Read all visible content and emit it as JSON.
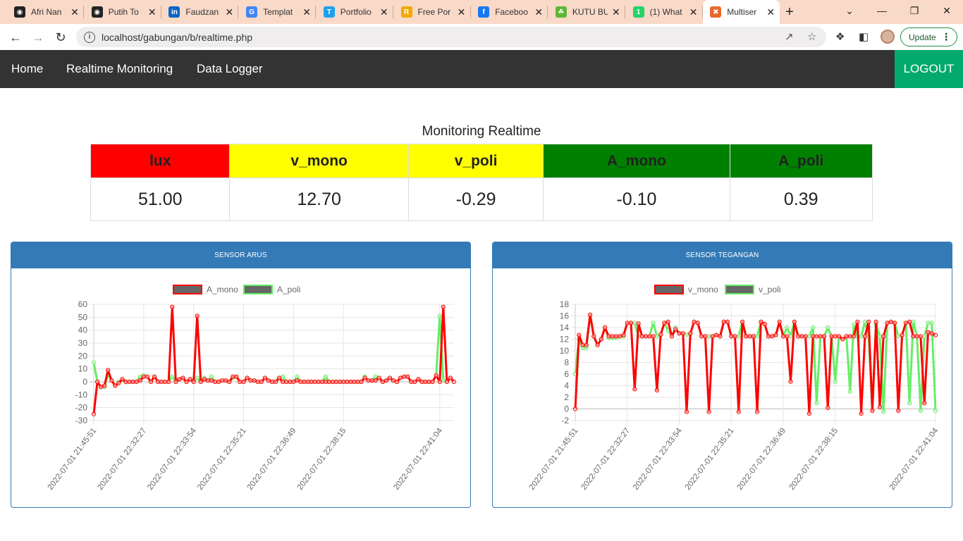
{
  "browser": {
    "tabs": [
      {
        "title": "Afri Nan",
        "icon": "github-icon",
        "color": "#222222"
      },
      {
        "title": "Putih To",
        "icon": "github-icon",
        "color": "#222222"
      },
      {
        "title": "Faudzan",
        "icon": "linkedin-icon",
        "color": "#0a66c2"
      },
      {
        "title": "Templat",
        "icon": "google-icon",
        "color": "#4285f4"
      },
      {
        "title": "Portfolio",
        "icon": "portfolio-icon",
        "color": "#1da1f2"
      },
      {
        "title": "Free Por",
        "icon": "freeport-icon",
        "color": "#f2a900"
      },
      {
        "title": "Faceboo",
        "icon": "facebook-icon",
        "color": "#1877f2"
      },
      {
        "title": "KUTU BU",
        "icon": "kutubu-icon",
        "color": "#5fb636"
      },
      {
        "title": "(1) What",
        "icon": "whatsapp-icon",
        "color": "#25d366"
      },
      {
        "title": "Multiser",
        "icon": "xampp-icon",
        "color": "#e8692c",
        "active": true
      }
    ],
    "url": "localhost/gabungan/b/realtime.php",
    "update_label": "Update"
  },
  "nav": {
    "links": [
      "Home",
      "Realtime Monitoring",
      "Data Logger"
    ],
    "logout": "LOGOUT"
  },
  "monitoring": {
    "title": "Monitoring Realtime",
    "columns": [
      {
        "label": "lux",
        "value": "51.00",
        "color": "#ff0000"
      },
      {
        "label": "v_mono",
        "value": "12.70",
        "color": "#ffff00"
      },
      {
        "label": "v_poli",
        "value": "-0.29",
        "color": "#ffff00"
      },
      {
        "label": "A_mono",
        "value": "-0.10",
        "color": "#008000"
      },
      {
        "label": "A_poli",
        "value": "0.39",
        "color": "#008000"
      }
    ]
  },
  "panels": {
    "arus_title": "SENSOR ARUS",
    "tegangan_title": "SENSOR TEGANGAN"
  },
  "chart_data": [
    {
      "type": "line",
      "title": "SENSOR ARUS",
      "ylim": [
        -30,
        60
      ],
      "yticks": [
        -30,
        -20,
        -10,
        0,
        10,
        20,
        30,
        40,
        50,
        60
      ],
      "xtick_labels": [
        "2022-07-01 21:45:51",
        "2022-07-01 22:32:27",
        "2022-07-01 22:33:54",
        "2022-07-01 22:35:21",
        "2022-07-01 22:36:49",
        "2022-07-01 22:38:15",
        "2022-07-01 22:41:04"
      ],
      "xtick_index": [
        0,
        14,
        28,
        42,
        56,
        70,
        97
      ],
      "legend_position": "top",
      "grid": true,
      "series": [
        {
          "name": "A_mono",
          "color": "#ff0000",
          "values": [
            -25,
            0,
            -4,
            -3,
            9,
            1,
            -3,
            -1,
            2,
            0,
            0,
            0,
            0,
            1,
            4,
            4,
            0,
            4,
            0,
            0,
            0,
            0,
            58,
            0,
            2,
            3,
            0,
            2,
            0,
            51,
            0,
            2,
            1,
            1,
            0,
            0,
            1,
            1,
            0,
            4,
            4,
            0,
            0,
            3,
            1,
            1,
            0,
            0,
            3,
            1,
            0,
            0,
            3,
            0,
            0,
            0,
            0,
            1,
            0,
            0,
            0,
            0,
            0,
            0,
            0,
            0,
            0,
            0,
            0,
            0,
            0,
            0,
            0,
            0,
            0,
            0,
            3,
            1,
            1,
            1,
            3,
            0,
            1,
            3,
            1,
            0,
            3,
            4,
            4,
            0,
            0,
            2,
            0,
            0,
            0,
            0,
            5,
            0,
            58,
            0,
            3,
            0
          ]
        },
        {
          "name": "A_poli",
          "color": "#66ee66",
          "values": [
            15,
            0,
            -4,
            -4,
            6,
            1,
            -3,
            0,
            2,
            0,
            0,
            0,
            0,
            4,
            5,
            4,
            0,
            4,
            0,
            0,
            0,
            0,
            4,
            0,
            2,
            3,
            0,
            2,
            0,
            3,
            0,
            3,
            1,
            4,
            0,
            0,
            1,
            1,
            0,
            3,
            4,
            0,
            0,
            3,
            1,
            1,
            0,
            0,
            3,
            1,
            0,
            0,
            3,
            4,
            0,
            0,
            0,
            4,
            0,
            0,
            0,
            0,
            0,
            0,
            0,
            4,
            0,
            0,
            0,
            0,
            0,
            0,
            0,
            0,
            0,
            0,
            4,
            1,
            1,
            4,
            3,
            0,
            1,
            3,
            1,
            0,
            3,
            4,
            4,
            0,
            0,
            2,
            0,
            0,
            0,
            0,
            5,
            51,
            1,
            0,
            3,
            0
          ]
        }
      ]
    },
    {
      "type": "line",
      "title": "SENSOR TEGANGAN",
      "ylim": [
        -2,
        18
      ],
      "yticks": [
        -2,
        0,
        2,
        4,
        6,
        8,
        10,
        12,
        14,
        16,
        18
      ],
      "xtick_labels": [
        "2022-07-01 21:45:51",
        "2022-07-01 22:32:27",
        "2022-07-01 22:33:54",
        "2022-07-01 22:35:21",
        "2022-07-01 22:36:49",
        "2022-07-01 22:38:15",
        "2022-07-01 22:41:04"
      ],
      "xtick_index": [
        0,
        14,
        28,
        42,
        56,
        70,
        97
      ],
      "legend_position": "top",
      "grid": true,
      "series": [
        {
          "name": "v_mono",
          "color": "#ff0000",
          "values": [
            0,
            12.7,
            11,
            11,
            16.2,
            12.5,
            11,
            12,
            14,
            12.5,
            12.5,
            12.5,
            12.5,
            12.7,
            14.8,
            14.8,
            3.4,
            14.7,
            12.5,
            12.5,
            12.5,
            12.5,
            3.2,
            12.8,
            14.8,
            15.0,
            12.5,
            13.7,
            13.0,
            13.0,
            -0.5,
            13.0,
            15.0,
            14.8,
            12.5,
            12.5,
            -0.5,
            12.5,
            12.7,
            12.5,
            15.0,
            15.0,
            12.5,
            12.5,
            -0.5,
            15.0,
            12.5,
            12.5,
            12.5,
            -0.5,
            15.0,
            14.6,
            12.5,
            12.5,
            12.7,
            15.0,
            12.5,
            12.5,
            4.7,
            15.0,
            12.5,
            12.5,
            12.5,
            -0.8,
            12.5,
            12.5,
            12.5,
            12.5,
            0.2,
            12.5,
            12.5,
            12.5,
            12.0,
            12.5,
            12.5,
            12.5,
            15.0,
            -0.8,
            12.5,
            15.0,
            -0.3,
            15.0,
            0.3,
            12.5,
            14.8,
            15.0,
            14.8,
            -0.3,
            12.7,
            14.8,
            15.0,
            12.5,
            12.5,
            12.5,
            1.0,
            13.2,
            13.0,
            12.7
          ]
        },
        {
          "name": "v_poli",
          "color": "#66ee66",
          "values": [
            6,
            12.0,
            10.5,
            10.5,
            16.2,
            12.5,
            11,
            12,
            14,
            12.2,
            12.2,
            12.2,
            12.5,
            12.5,
            14.8,
            14.8,
            14.8,
            12.5,
            12.5,
            12.5,
            12.5,
            14.8,
            12.5,
            12.8,
            14.8,
            13.5,
            12.5,
            14.0,
            13.0,
            13.0,
            12.8,
            13.0,
            15.0,
            14.8,
            12.5,
            12.5,
            12.5,
            12.5,
            12.7,
            12.5,
            15.0,
            15.0,
            12.5,
            12.5,
            12.5,
            15.0,
            12.5,
            12.5,
            12.5,
            12.5,
            15.0,
            14.6,
            12.5,
            12.5,
            12.7,
            15.0,
            12.5,
            14.0,
            12.5,
            15.0,
            12.5,
            12.5,
            12.5,
            12.5,
            14.0,
            1.0,
            12.5,
            12.5,
            14.0,
            12.5,
            4.7,
            12.5,
            12.0,
            12.5,
            3.0,
            14.5,
            12.5,
            12.5,
            15.0,
            12.5,
            -0.3,
            14.5,
            12.5,
            -0.5,
            14.8,
            15.0,
            14.8,
            12.5,
            12.7,
            14.8,
            1.0,
            15.0,
            12.5,
            -0.3,
            12.5,
            14.8,
            14.8,
            -0.3
          ]
        }
      ]
    }
  ]
}
